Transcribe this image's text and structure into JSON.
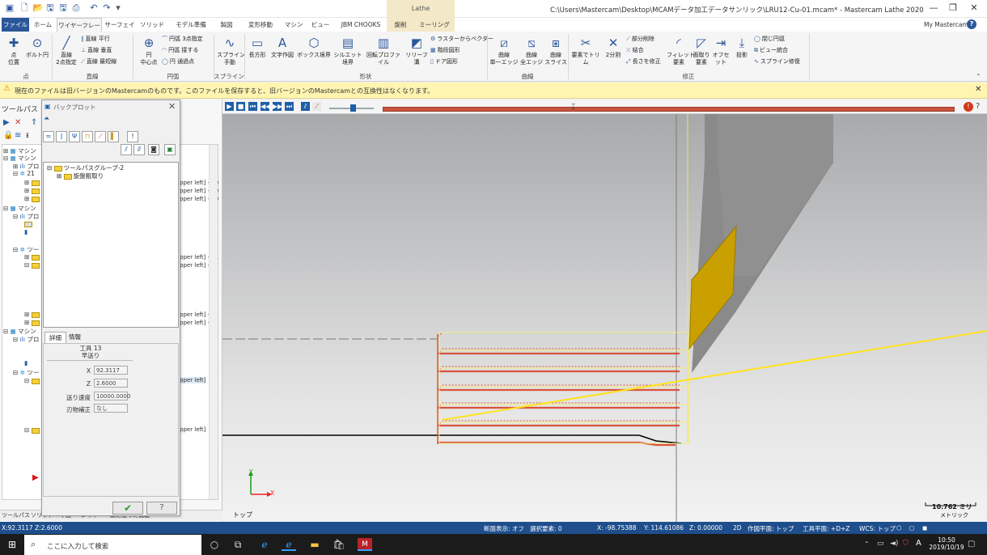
{
  "titlebar": {
    "title": "C:\\Users\\Mastercam\\Desktop\\MCAMデータ加工データサンリック\\LRU12-Cu-01.mcam* - Mastercam Lathe 2020",
    "context_tab": "Lathe"
  },
  "tabs": [
    "ファイル",
    "ホーム",
    "ワイヤーフレーム",
    "サーフェイス",
    "ソリッド",
    "モデル準備",
    "製図",
    "変形移動",
    "マシン",
    "ビュー",
    "JBM CHOOKS",
    "旋削",
    "ミーリング"
  ],
  "active_tab": "ワイヤーフレーム",
  "my_mastercam": "My Mastercam",
  "ribbon": {
    "groups": [
      "点",
      "直線",
      "円弧",
      "スプライン",
      "形状",
      "曲線",
      "修正"
    ],
    "point": {
      "point_pos": "点\n位置",
      "bolt_circle": "ボルト円"
    },
    "line": {
      "endpoints": "直線\n2点指定",
      "parallel": "直線 平行",
      "perpendicular": "直線 垂直",
      "closest": "直線 最短線"
    },
    "arc": {
      "circle_center": "円\n中心点",
      "arc_3pt": "円弧 3点指定",
      "arc_tangent": "円弧 接する",
      "circle_edge": "円 通過点"
    },
    "spline": {
      "manual": "スプライン\n手動"
    },
    "shapes": {
      "rectangle": "長方形",
      "text": "文字作図",
      "bounding_box": "ボックス境界",
      "silhouette": "シルエット境界",
      "turn_profile": "回転プロファイル",
      "relief_groove": "リリーフ溝",
      "raster_vector": "ラスターからベクター",
      "stair": "階段図形",
      "door": "ドア図形"
    },
    "curves": {
      "single_edge": "曲線\n単一エッジ",
      "all_edges": "曲線\n全エッジ",
      "slice": "曲線\nスライス"
    },
    "modify": {
      "trim_element": "要素でトリム",
      "divide2": "2分割",
      "partial_delete": "部分削除",
      "join": "結合",
      "modify_length": "長さを修正",
      "fillet": "フィレット\n要素",
      "chamfer": "面取り\n要素",
      "offset": "オフセット",
      "project": "投影",
      "closed_arc": "閉じ円弧",
      "view_merge": "ビュー統合",
      "spline_mod": "スプライン修復"
    }
  },
  "warning": "現在のファイルは旧バージョンのMastercamのものです。このファイルを保存すると、旧バージョンのMastercamとの互換性はなくなります。",
  "left_panel": {
    "title": "ツールパス",
    "tree_rows": [
      "マシン",
      "マシン",
      "プロ",
      "21",
      "",
      "",
      "",
      "マシン",
      "プロ",
      "",
      "",
      "ツー",
      "",
      "",
      "",
      "",
      "マシン",
      "プロ",
      "",
      "ツー",
      "",
      ""
    ],
    "fragments": [
      "pper left] - 20",
      "pper left] - 20",
      "pper left] - 20",
      "pper left] - 21",
      "pper left] - 2",
      "pper left] - 2",
      "pper left] - 2",
      "pper left]",
      "pper left]"
    ],
    "bottom_tabs": [
      "ツールパス",
      "ソリッド",
      "平面",
      "レイヤー",
      "最近使った機能"
    ]
  },
  "backplot": {
    "title": "バックプロット",
    "tree": {
      "group": "ツールパスグループ-2",
      "op": "旋盤粗取り"
    },
    "tabs": [
      "詳細",
      "情報"
    ],
    "tool_label": "工具 13",
    "move_type": "早送り",
    "fields": [
      {
        "label": "X",
        "value": "92.3117"
      },
      {
        "label": "Z",
        "value": "2.6000"
      },
      {
        "label": "送り速度",
        "value": "10000.0000"
      },
      {
        "label": "刃物補正",
        "value": "なし"
      }
    ]
  },
  "viewport": {
    "view_name": "トップ",
    "scale_value": "10.762 ミリ",
    "scale_unit": "メトリック",
    "axis_x": "X",
    "axis_y": "Y"
  },
  "statusbar": {
    "coords_left": "X:92.3117  Z:2.6000",
    "section": "断面表示: オフ",
    "selected": "選択要素: 0",
    "x": "X:   -98.75388",
    "y": "Y:   114.61086",
    "z": "Z:   0.00000",
    "mode": "2D",
    "cplane": "作図平面: トップ",
    "tplane": "工具平面: +D+Z",
    "wcs": "WCS: トップ"
  },
  "taskbar": {
    "search_placeholder": "ここに入力して検索",
    "ime": "A",
    "time": "10:50",
    "date": "2019/10/19"
  },
  "colors": {
    "accent": "#2b579a",
    "statusbar": "#1e4e8c",
    "toolpath": "#d9533f",
    "tool": "#c9a000",
    "warning_bg": "#fff5b1"
  }
}
